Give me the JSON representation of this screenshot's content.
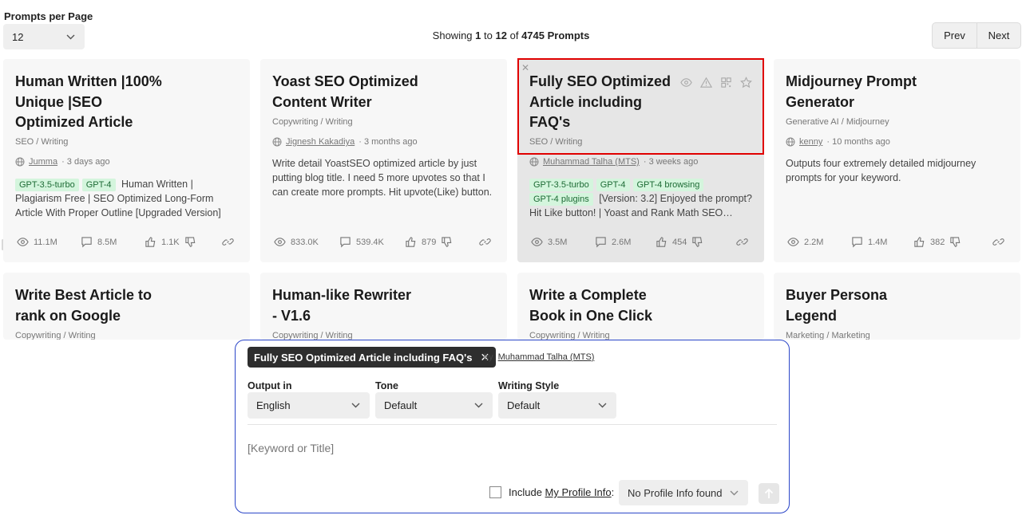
{
  "topbar": {
    "per_page_label": "Prompts per Page",
    "per_page_value": "12",
    "showing_prefix": "Showing",
    "showing_from": "1",
    "showing_to_word": "to",
    "showing_to": "12",
    "showing_of_word": "of",
    "showing_total": "4745 Prompts",
    "prev_label": "Prev",
    "next_label": "Next"
  },
  "cards": [
    {
      "title": "Human Written |100% Unique |SEO Optimized Article",
      "category": "SEO / Writing",
      "author": "Jumma",
      "time": "· 3 days ago",
      "tags": [
        "GPT-3.5-turbo",
        "GPT-4"
      ],
      "desc": "Human Written | Plagiarism Free | SEO Optimized Long-Form Article With Proper Outline [Upgraded Version]",
      "views": "11.1M",
      "comments": "8.5M",
      "likes": "1.1K"
    },
    {
      "title": "Yoast SEO Optimized Content Writer",
      "category": "Copywriting / Writing",
      "author": "Jignesh Kakadiya",
      "time": "· 3 months ago",
      "tags": [],
      "desc": "Write detail YoastSEO optimized article by just putting blog title. I need 5 more upvotes so that I can create more prompts. Hit upvote(Like) button.",
      "views": "833.0K",
      "comments": "539.4K",
      "likes": "879"
    },
    {
      "title": "Fully SEO Optimized Article including FAQ's",
      "category": "SEO / Writing",
      "author": "Muhammad Talha (MTS)",
      "time": "· 3 weeks ago",
      "tags": [
        "GPT-3.5-turbo",
        "GPT-4",
        "GPT-4 browsing",
        "GPT-4 plugins"
      ],
      "desc": "[Version: 3.2] Enjoyed the prompt? Hit Like button! | Yoast and Rank Math SEO…",
      "views": "3.5M",
      "comments": "2.6M",
      "likes": "454"
    },
    {
      "title": "Midjourney Prompt Generator",
      "category": "Generative AI / Midjourney",
      "author": "kenny",
      "time": "· 10 months ago",
      "tags": [],
      "desc": "Outputs four extremely detailed midjourney prompts for your keyword.",
      "views": "2.2M",
      "comments": "1.4M",
      "likes": "382"
    },
    {
      "title": "Write Best Article to rank on Google",
      "category": "Copywriting / Writing"
    },
    {
      "title": "Human-like Rewriter - V1.6",
      "category": "Copywriting / Writing"
    },
    {
      "title": "Write a Complete Book in One Click",
      "category": "Copywriting / Writing"
    },
    {
      "title": "Buyer Persona Legend",
      "category": "Marketing / Marketing"
    }
  ],
  "popup": {
    "chip_title": "Fully SEO Optimized Article including FAQ's",
    "by_label": "by",
    "author": "Muhammad Talha (MTS)",
    "output_label": "Output in",
    "output_value": "English",
    "tone_label": "Tone",
    "tone_value": "Default",
    "style_label": "Writing Style",
    "style_value": "Default",
    "prompt_placeholder": "[Keyword or Title]",
    "include_label": "Include",
    "profile_link": "My Profile Info",
    "colon": ":",
    "profile_select": "No Profile Info found"
  },
  "colors": {
    "tag_bg": "#d4f5dd",
    "tag_text": "#1d6b35",
    "popup_border": "#2b46c8",
    "highlight": "#e00000",
    "chip_bg": "#2e2e2e"
  }
}
